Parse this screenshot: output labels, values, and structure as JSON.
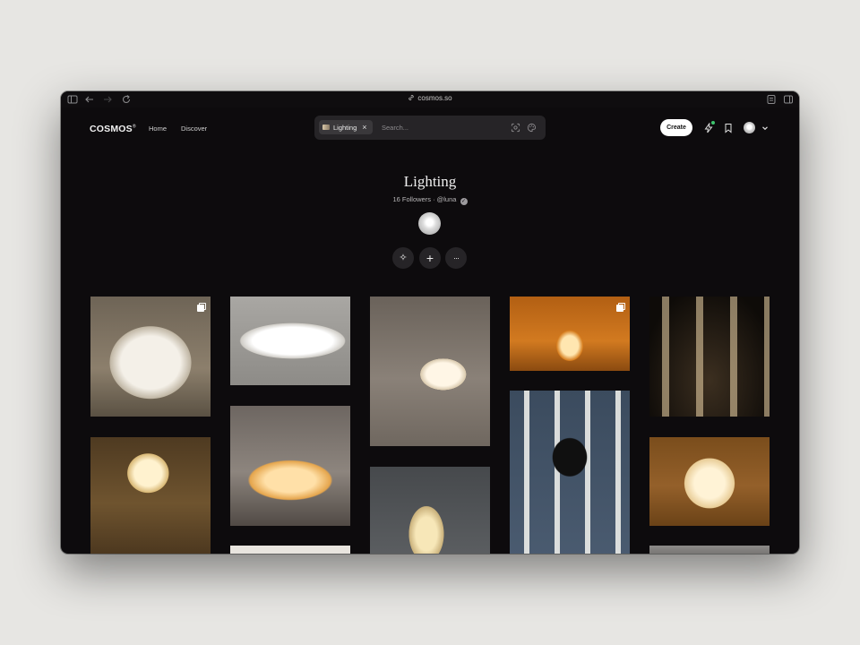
{
  "browser": {
    "url": "cosmos.so"
  },
  "header": {
    "logo": "COSMOS",
    "logo_mark": "®",
    "nav": [
      {
        "label": "Home"
      },
      {
        "label": "Discover"
      }
    ],
    "search": {
      "chip_label": "Lighting",
      "placeholder": "Search..."
    },
    "create_label": "Create"
  },
  "cluster": {
    "title": "Lighting",
    "followers": "16 Followers",
    "separator": "·",
    "handle": "@luna",
    "verified_mark": "✓"
  },
  "actions": [
    {
      "icon": "sparkle-icon",
      "glyph": "✧"
    },
    {
      "icon": "plus-icon",
      "glyph": "+"
    },
    {
      "icon": "more-icon",
      "glyph": "···"
    }
  ],
  "grid": {
    "tiles": [
      {
        "subject": "white cocoon pendant lamp",
        "column": 1,
        "stacked": true
      },
      {
        "subject": "long rectangular paper lamp",
        "column": 2,
        "stacked": false
      },
      {
        "subject": "round paper pendant lamp",
        "column": 3,
        "stacked": false
      },
      {
        "subject": "small lantern table lamp",
        "column": 4,
        "stacked": true
      },
      {
        "subject": "stacked cylinder floor lamps",
        "column": 5,
        "stacked": false
      },
      {
        "subject": "tripod floor lamp",
        "column": 1,
        "stacked": false
      },
      {
        "subject": "oval paper floor lamp",
        "column": 2,
        "stacked": false
      },
      {
        "subject": "sculptural black pendant chandelier",
        "column": 4,
        "stacked": false
      },
      {
        "subject": "white pendant lamp on brown wall",
        "column": 5,
        "stacked": false
      },
      {
        "subject": "folded paper pendant",
        "column": 3,
        "stacked": false
      },
      {
        "subject": "light image",
        "column": 2,
        "stacked": false
      },
      {
        "subject": "partial image",
        "column": 5,
        "stacked": false
      }
    ]
  }
}
